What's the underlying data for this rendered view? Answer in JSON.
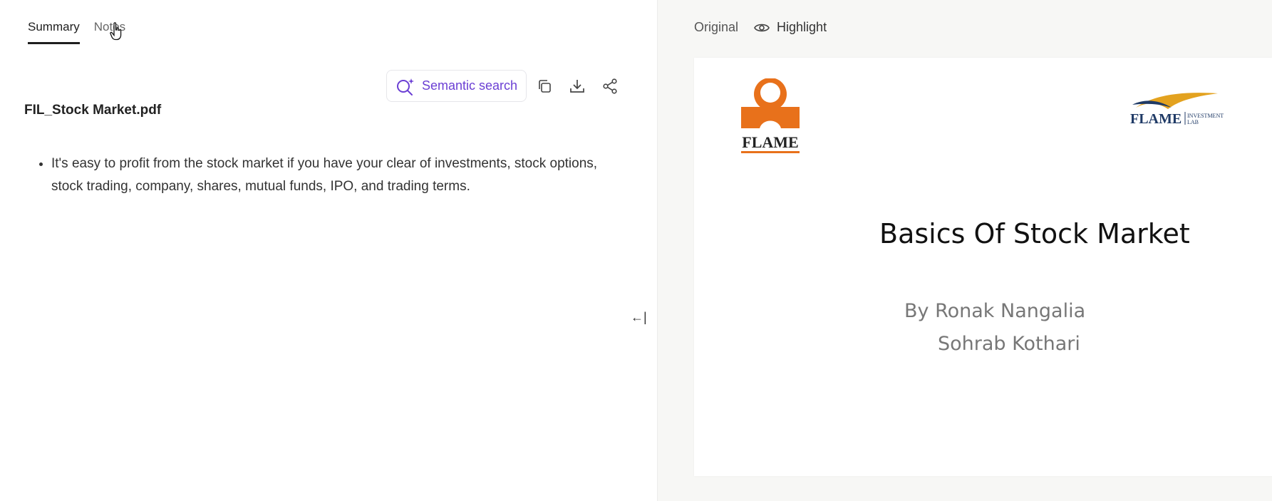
{
  "tabs": [
    {
      "label": "Summary",
      "active": true
    },
    {
      "label": "Notes",
      "active": false
    }
  ],
  "toolbar": {
    "semantic_search_label": "Semantic search",
    "accent_color": "#6b3fd4"
  },
  "document": {
    "filename": "FIL_Stock Market.pdf",
    "summary_points": [
      "It's easy to profit from the stock market if you have your clear of investments, stock options, stock trading, company, shares, mutual funds, IPO, and trading terms."
    ]
  },
  "collapse_label": "←|",
  "viewer": {
    "original_label": "Original",
    "highlight_label": "Highlight",
    "page": {
      "title": "Basics Of Stock Market",
      "by_line1": "By  Ronak Nangalia",
      "by_line2": "Sohrab Kothari",
      "flame_logo_text": "FLAME",
      "fil_logo_text": "FLAME",
      "fil_logo_sub": "INVESTMENT LAB"
    }
  },
  "icons": [
    "sparkle-search-icon",
    "copy-icon",
    "download-icon",
    "share-icon",
    "eye-icon",
    "collapse-arrow-icon",
    "hand-cursor-icon"
  ]
}
